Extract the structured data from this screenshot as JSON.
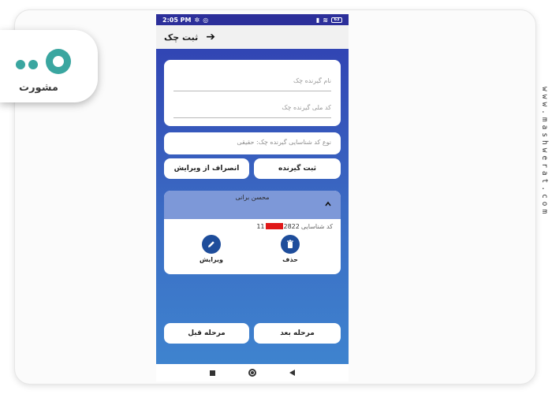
{
  "status_bar": {
    "time": "2:05 PM",
    "battery": "63"
  },
  "header": {
    "title": "ثبت چک",
    "back_icon": "arrow-right-icon"
  },
  "form": {
    "receiver_name_placeholder": "نام گیرنده چک",
    "receiver_national_id_placeholder": "کد ملی گیرنده چک",
    "receiver_id_type_placeholder": "نوع کد شناسایی گیرنده چک: حقیقی"
  },
  "buttons": {
    "register_receiver": "ثبت گیرنده",
    "cancel_edit": "انصراف از ویرایش",
    "next_step": "مرحله بعد",
    "previous_step": "مرحله قبل"
  },
  "receiver": {
    "name": "محسن برانی",
    "id_label": "کد شناسایی",
    "id_prefix": "11",
    "id_suffix": "2822",
    "delete_label": "حذف",
    "edit_label": "ویرایش"
  },
  "branding": {
    "logo_text": "مشورت",
    "side_watermark": "www.mashwerat.com"
  },
  "colors": {
    "primary": "#2f3db0",
    "accent_button": "#1e4d9b",
    "receiver_header": "#7d98d8",
    "mask": "#e01818"
  }
}
